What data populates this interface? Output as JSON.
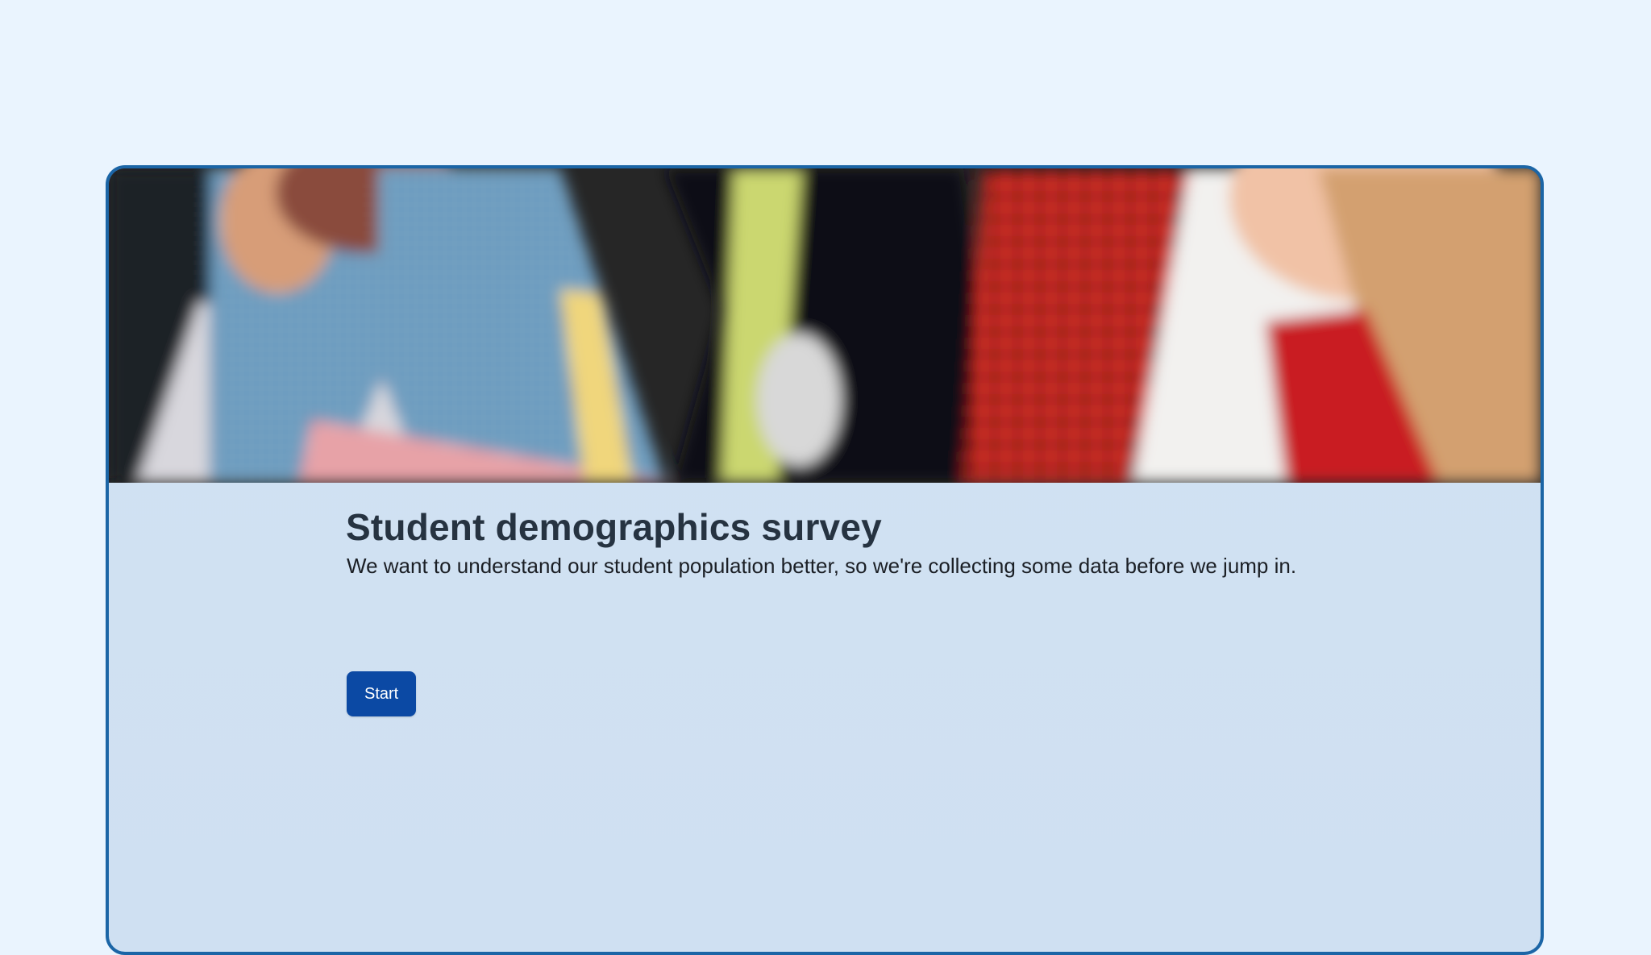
{
  "survey": {
    "title": "Student demographics survey",
    "description": "We want to understand our student population better, so we're collecting some data before we jump in.",
    "start_label": "Start"
  },
  "hero": {
    "image_name": "students-photo"
  },
  "colors": {
    "page_background": "#eaf4fe",
    "card_border": "#1b65a6",
    "card_background": "#d1e2f3",
    "button": "#0b49a4",
    "button_text": "#ffffff",
    "title_text": "#263341"
  }
}
